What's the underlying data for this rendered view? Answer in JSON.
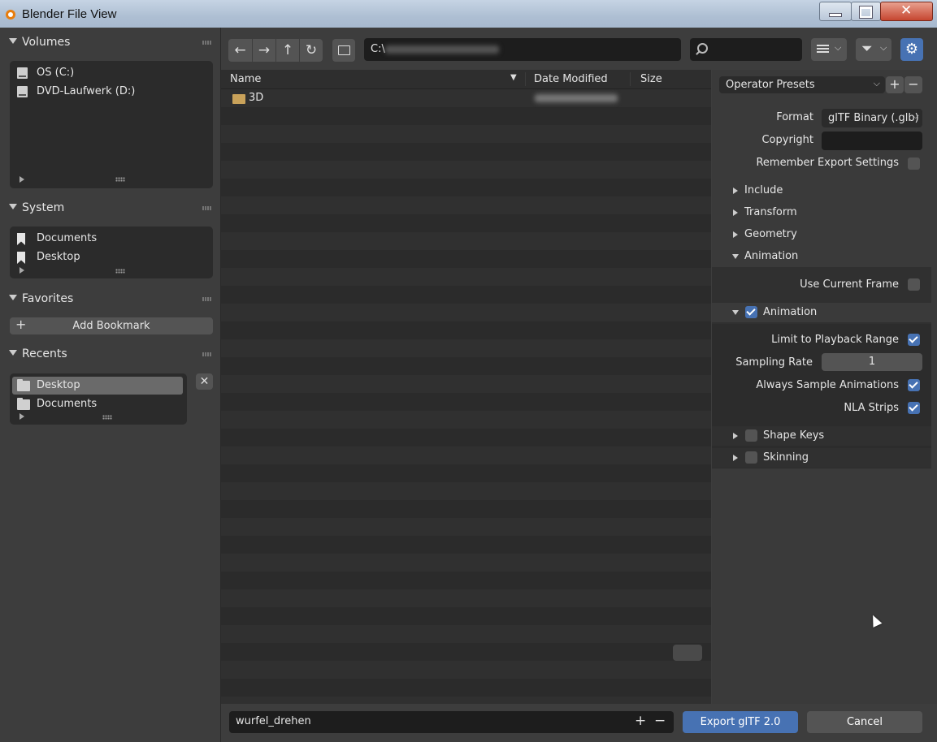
{
  "window": {
    "title": "Blender File View"
  },
  "volumes": {
    "header": "Volumes",
    "items": [
      {
        "label": "OS (C:)",
        "icon": "drive-icon"
      },
      {
        "label": "DVD-Laufwerk (D:)",
        "icon": "drive-icon"
      }
    ]
  },
  "system": {
    "header": "System",
    "items": [
      {
        "label": "Documents",
        "icon": "bookmark-icon"
      },
      {
        "label": "Desktop",
        "icon": "bookmark-icon"
      }
    ]
  },
  "favorites": {
    "header": "Favorites",
    "add_label": "Add Bookmark"
  },
  "recents": {
    "header": "Recents",
    "items": [
      {
        "label": "Desktop",
        "icon": "folder-icon",
        "selected": true
      },
      {
        "label": "Documents",
        "icon": "folder-icon",
        "selected": false
      }
    ]
  },
  "path": {
    "value": "C:\\"
  },
  "columns": {
    "name": "Name",
    "date": "Date Modified",
    "size": "Size"
  },
  "files": [
    {
      "name": "3D",
      "icon": "folder-icon"
    }
  ],
  "settings": {
    "presets_label": "Operator Presets",
    "format_label": "Format",
    "format_value": "glTF Binary (.glb)",
    "copyright_label": "Copyright",
    "copyright_value": "",
    "remember_label": "Remember Export Settings",
    "sections": {
      "include": "Include",
      "transform": "Transform",
      "geometry": "Geometry",
      "animation": "Animation"
    },
    "use_current_frame": "Use Current Frame",
    "animation_sub": "Animation",
    "limit_playback": "Limit to Playback Range",
    "sampling_rate_label": "Sampling Rate",
    "sampling_rate_value": "1",
    "always_sample": "Always Sample Animations",
    "nla_strips": "NLA Strips",
    "shape_keys": "Shape Keys",
    "skinning": "Skinning"
  },
  "footer": {
    "filename": "wurfel_drehen",
    "export_label": "Export glTF 2.0",
    "cancel_label": "Cancel"
  },
  "colors": {
    "accent": "#4772b3",
    "panel": "#3d3d3d",
    "field": "#1d1d1d"
  }
}
